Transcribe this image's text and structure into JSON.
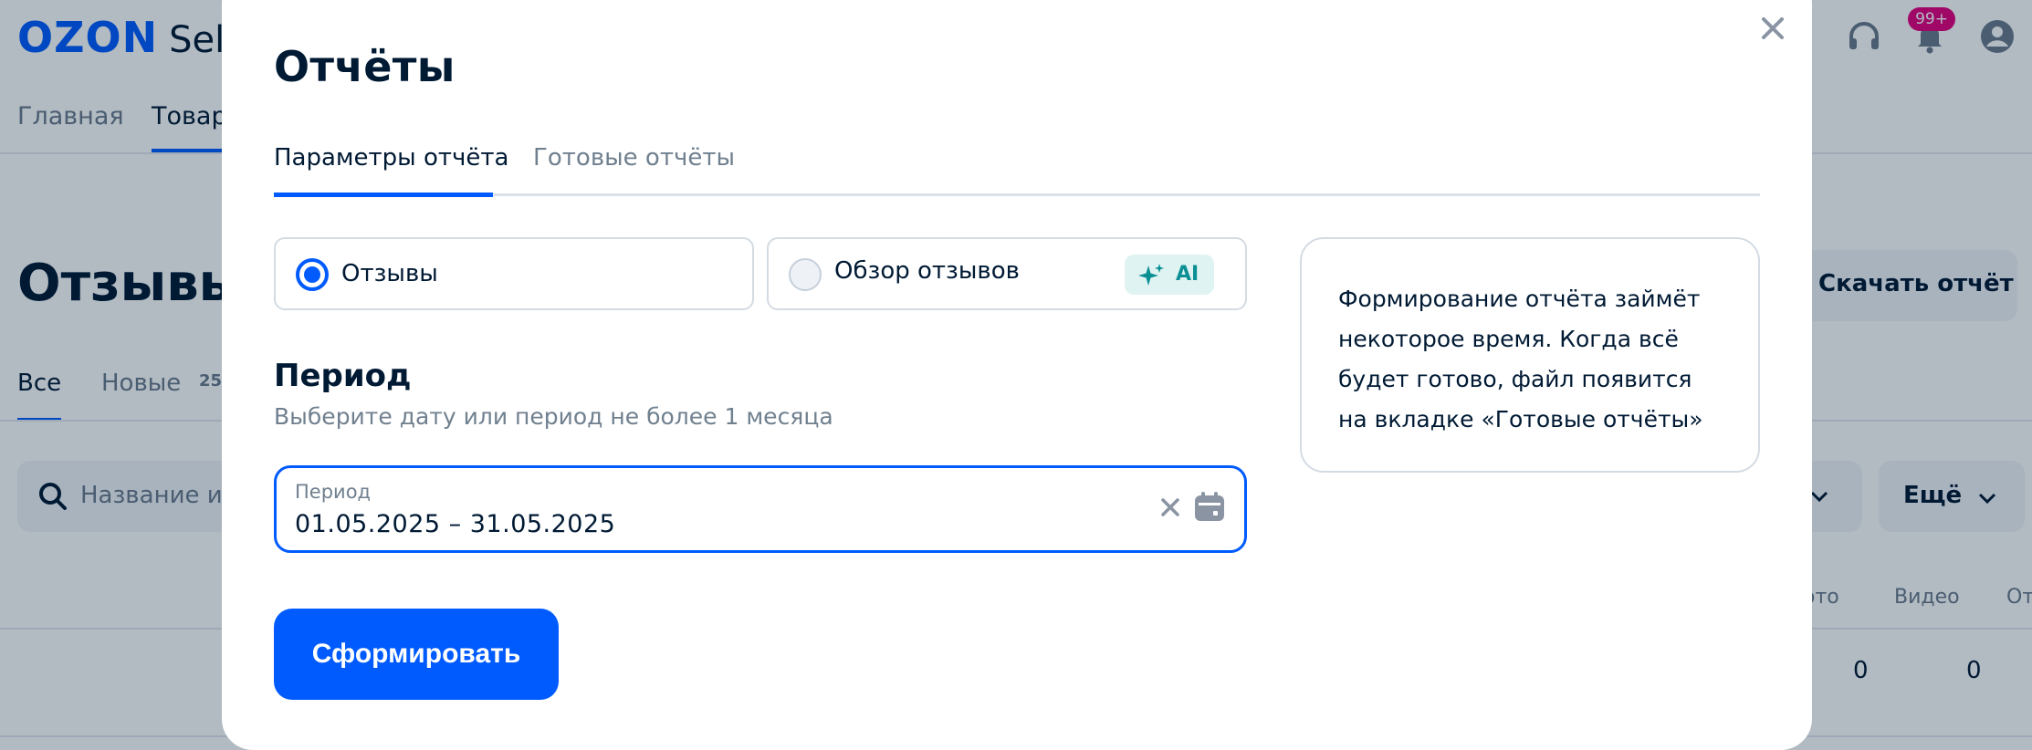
{
  "background": {
    "logo": "OZON",
    "logo_suffix": "Sel",
    "notifications_badge": "99+",
    "nav_tabs": [
      "Главная",
      "Товар"
    ],
    "page_heading": "Отзывы",
    "filters": [
      "Все",
      "Новые"
    ],
    "new_count": "25",
    "search_placeholder": "Название и",
    "download_button": "Скачать отчёт",
    "more_button": "Ещё",
    "columns": [
      "ото",
      "Видео",
      "От"
    ],
    "row_values": [
      "0",
      "0"
    ]
  },
  "modal": {
    "title": "Отчёты",
    "tabs": [
      {
        "label": "Параметры отчёта",
        "active": true
      },
      {
        "label": "Готовые отчёты",
        "active": false
      }
    ],
    "report_types": [
      {
        "label": "Отзывы",
        "checked": true
      },
      {
        "label": "Обзор отзывов",
        "checked": false,
        "badge": "AI"
      }
    ],
    "info": "Формирование отчёта займёт некоторое время. Когда всё будет готово, файл появится на вкладке «Готовые отчёты»",
    "period": {
      "title": "Период",
      "hint": "Выберите дату или период не более 1 месяца",
      "field_label": "Период",
      "value": "01.05.2025 – 31.05.2025"
    },
    "submit_label": "Сформировать"
  },
  "colors": {
    "accent": "#005bff",
    "text_primary": "#001a34",
    "text_secondary": "#70808f",
    "ai_badge_bg": "#dff4f2",
    "ai_badge_text": "#0a8f95",
    "notification_badge": "#e6007e"
  },
  "icons": [
    "close-icon",
    "headset-icon",
    "bell-icon",
    "profile-icon",
    "search-icon",
    "sparkle-icon",
    "calendar-icon",
    "clear-icon",
    "chevron-down-icon"
  ]
}
